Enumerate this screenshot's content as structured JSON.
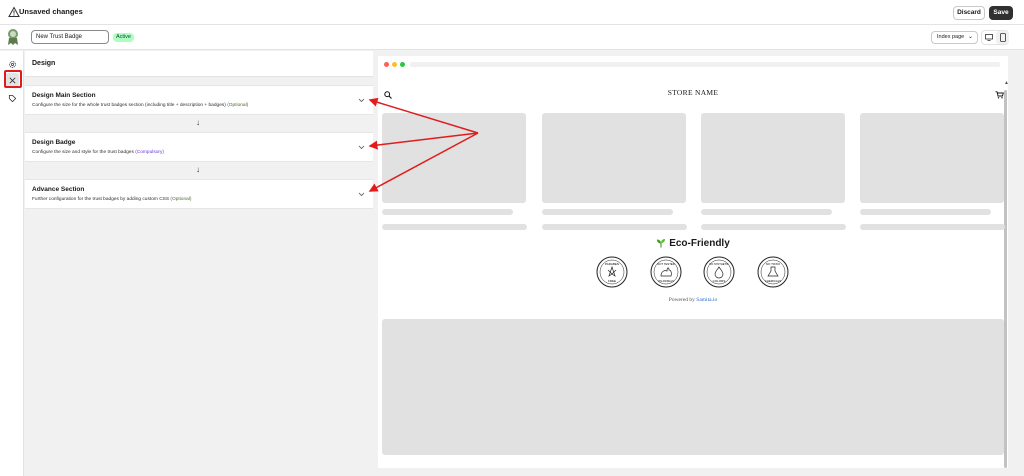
{
  "topbar": {
    "title": "Unsaved changes",
    "discard_label": "Discard",
    "save_label": "Save"
  },
  "subbar": {
    "badge_name_value": "New Trust Badge",
    "status_badge": "Active",
    "page_select": "Index page"
  },
  "panel": {
    "title": "Design",
    "sections": [
      {
        "title": "Design Main Section",
        "description": "Configure the size for the whole trust badges section (including title + description + badges)",
        "tag": "(Optional)"
      },
      {
        "title": "Design Badge",
        "description": "Configure the size and style for the trust badges",
        "tag": "(Compulsory)"
      },
      {
        "title": "Advance Section",
        "description": "Further configuration for the trust badges by adding custom CSS",
        "tag": "(Optional)"
      }
    ],
    "down_arrow": "↓"
  },
  "preview": {
    "store_name": "STORE NAME",
    "eco_title": "Eco-Friendly",
    "badges": [
      {
        "top": "PARABEN",
        "bottom": "FREE",
        "icon": "flower-icon"
      },
      {
        "top": "NOT TESTED",
        "bottom": "ON ANIMALS",
        "icon": "rabbit-icon"
      },
      {
        "top": "NO SYNTHETIC",
        "bottom": "COLORS",
        "icon": "drop-icon"
      },
      {
        "top": "NO TOXIC",
        "bottom": "CHEMICALS",
        "icon": "flask-icon"
      }
    ],
    "powered_prefix": "Powered by",
    "powered_link": "Samita.io"
  },
  "colors": {
    "save_bg": "#303030",
    "active_bg": "#affebf",
    "annotation_red": "#e01c1c",
    "link": "#2c6ecb"
  }
}
